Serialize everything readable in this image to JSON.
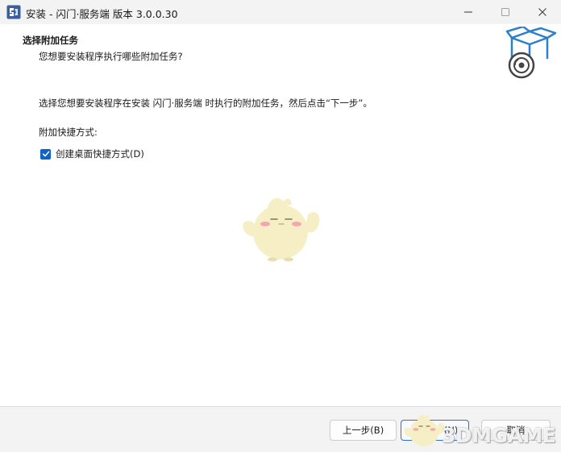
{
  "window": {
    "title": "安装 - 闪门·服务端 版本 3.0.0.30"
  },
  "header": {
    "title": "选择附加任务",
    "subtitle": "您想要安装程序执行哪些附加任务?"
  },
  "body": {
    "instruction": "选择您想要安装程序在安装 闪门·服务端 时执行的附加任务，然后点击“下一步”。",
    "group_label": "附加快捷方式:",
    "checkbox": {
      "label": "创建桌面快捷方式(D)",
      "checked": true
    }
  },
  "footer": {
    "back_label": "上一步(B)",
    "next_label": "(N)",
    "cancel_label": "取消"
  },
  "watermark": {
    "text": "3DMGAME"
  },
  "colors": {
    "accent": "#0f62c6",
    "footer_bg": "#f3f3f3",
    "mascot_body": "#f6efc6"
  },
  "icons": {
    "app": "installer-app-icon",
    "minimize": "minimize-icon",
    "maximize": "maximize-icon",
    "close": "close-icon",
    "header": "box-disc-icon",
    "check": "checkmark-icon"
  }
}
